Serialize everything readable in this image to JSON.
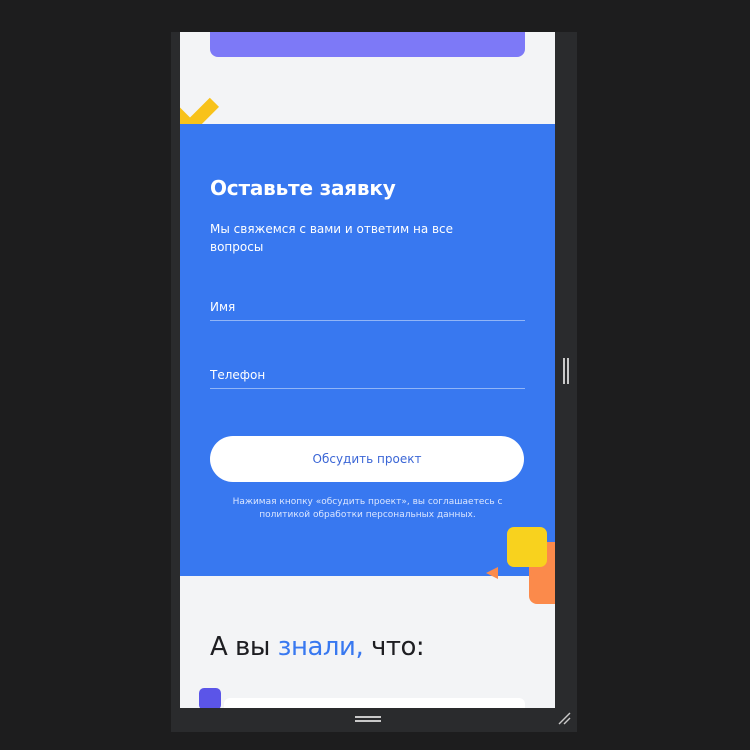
{
  "form": {
    "title": "Оставьте заявку",
    "subtitle": "Мы свяжемся с вами и ответим на все вопросы",
    "name_placeholder": "Имя",
    "phone_placeholder": "Телефон",
    "submit_label": "Обсудить проект",
    "consent_text": "Нажимая кнопку «обсудить проект», вы соглашаетесь с политикой обработки персональных данных."
  },
  "facts": {
    "title_before": "А вы ",
    "title_highlight": "знали,",
    "title_after": " что:"
  },
  "colors": {
    "form_background": "#3878f0",
    "accent_purple": "#7d79f7",
    "accent_yellow": "#f8d21e",
    "accent_orange": "#fb8a4b",
    "highlight_blue": "#3878f0"
  },
  "icons": {
    "cross": "cross-decoration-icon",
    "resize": "resize-grip-icon"
  }
}
